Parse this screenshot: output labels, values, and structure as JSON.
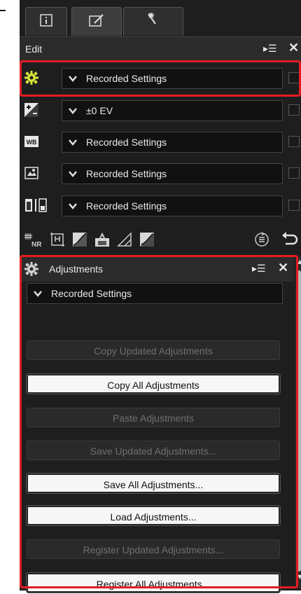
{
  "tabs": [
    {
      "name": "info",
      "icon": "info-icon"
    },
    {
      "name": "edit",
      "icon": "edit-icon"
    },
    {
      "name": "tools",
      "icon": "tools-icon"
    }
  ],
  "edit_panel": {
    "title": "Edit",
    "rows": [
      {
        "icon": "gear-icon",
        "value": "Recorded Settings"
      },
      {
        "icon": "exposure-icon",
        "value": "±0 EV"
      },
      {
        "icon": "wb-icon",
        "value": "Recorded Settings"
      },
      {
        "icon": "picture-control-icon",
        "value": "Recorded Settings"
      },
      {
        "icon": "tone-icon",
        "value": "Recorded Settings"
      }
    ],
    "toolbar_icons": [
      "noise-reduction-icon",
      "crop-icon",
      "levels-icon",
      "lch-icon",
      "color-balance-icon",
      "adjust-icon",
      "history-icon",
      "undo-icon"
    ]
  },
  "adjustments_panel": {
    "title": "Adjustments",
    "dropdown_value": "Recorded Settings",
    "buttons": [
      {
        "label": "Copy Updated Adjustments",
        "enabled": false
      },
      {
        "label": "Copy All Adjustments",
        "enabled": true
      },
      {
        "label": "Paste Adjustments",
        "enabled": false
      },
      {
        "label": "Save Updated Adjustments...",
        "enabled": false
      },
      {
        "label": "Save All Adjustments...",
        "enabled": true
      },
      {
        "label": "Load Adjustments...",
        "enabled": true
      },
      {
        "label": "Register Updated Adjustments...",
        "enabled": false
      },
      {
        "label": "Register All Adjustments...",
        "enabled": true
      }
    ]
  },
  "accent_color": "#e31b23",
  "gear_color": "#d7e63a"
}
